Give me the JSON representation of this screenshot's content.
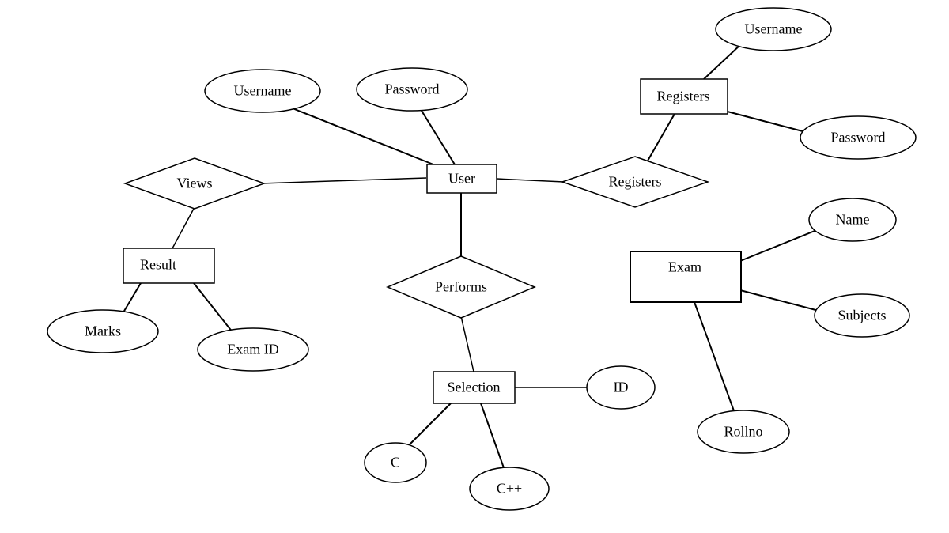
{
  "entities": {
    "user": "User",
    "result": "Result",
    "selection": "Selection",
    "exam": "Exam",
    "registers_entity": "Registers"
  },
  "relationships": {
    "views": "Views",
    "performs": "Performs",
    "registers_rel": "Registers"
  },
  "attributes": {
    "user_username": "Username",
    "user_password": "Password",
    "registers_username": "Username",
    "registers_password": "Password",
    "result_marks": "Marks",
    "result_examid": "Exam ID",
    "selection_id": "ID",
    "selection_c": "C",
    "selection_cpp": "C++",
    "exam_name": "Name",
    "exam_subjects": "Subjects",
    "exam_rollno": "Rollno"
  }
}
